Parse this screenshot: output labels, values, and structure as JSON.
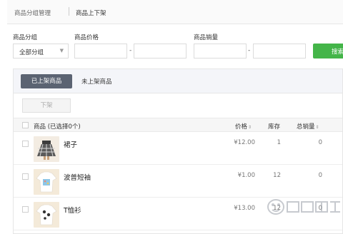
{
  "breadcrumb": {
    "parent": "商品分组管理",
    "current": "商品上下架"
  },
  "filters": {
    "group_label": "商品分组",
    "group_value": "全部分组",
    "price_label": "商品价格",
    "sales_label": "商品销量",
    "range_sep": "-",
    "search_label": "搜索"
  },
  "tabs": {
    "active": "已上架商品",
    "inactive": "未上架商品"
  },
  "actions": {
    "delist": "下架"
  },
  "table": {
    "headers": {
      "product": "商品 (已选择0个)",
      "price": "价格",
      "stock": "库存",
      "sales": "总销量"
    },
    "rows": [
      {
        "name": "裙子",
        "price": "¥12.00",
        "stock": "1",
        "sales": "0"
      },
      {
        "name": "波普短袖",
        "price": "¥1.00",
        "stock": "12",
        "sales": "0"
      },
      {
        "name": "T恤衫",
        "price": "¥13.00",
        "stock": "12",
        "sales": "0"
      }
    ]
  },
  "colors": {
    "accent_green": "#44b549",
    "tab_active_bg": "#5b6372"
  }
}
